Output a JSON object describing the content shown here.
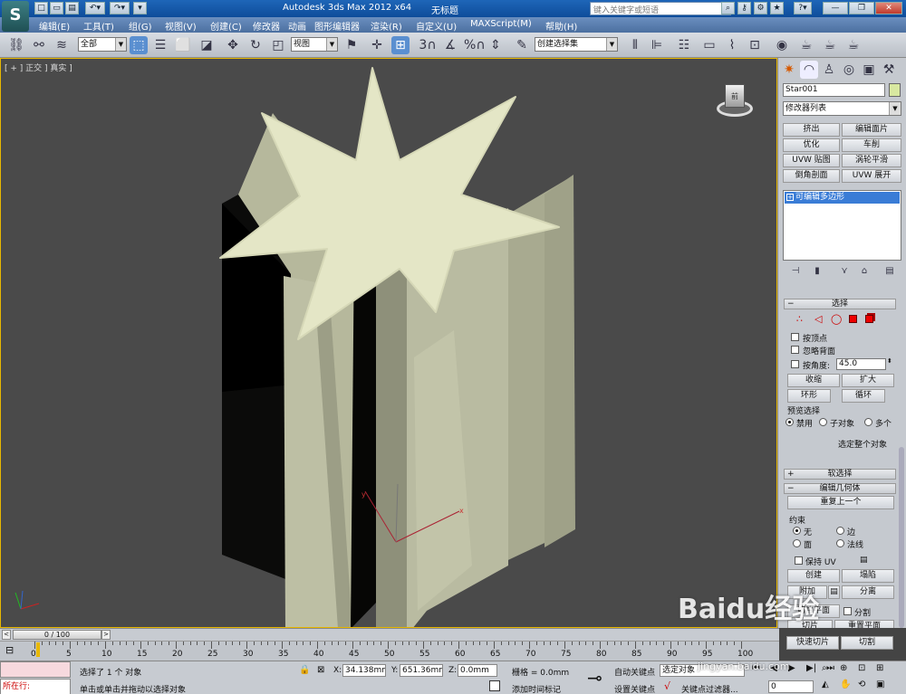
{
  "titlebar": {
    "app_title": "Autodesk 3ds Max  2012 x64",
    "doc_title": "无标题",
    "search_placeholder": "键入关键字或短语"
  },
  "menubar": {
    "items": [
      "编辑(E)",
      "工具(T)",
      "组(G)",
      "视图(V)",
      "创建(C)",
      "修改器",
      "动画",
      "图形编辑器",
      "渲染(R)",
      "自定义(U)",
      "MAXScript(M)",
      "帮助(H)"
    ]
  },
  "toolbar": {
    "selection_filter": "全部",
    "reference_coord": "视图",
    "named_selection": "创建选择集",
    "snap_label": "3",
    "percent_label": "%"
  },
  "viewport": {
    "label": "[ + ] 正交 ] 真实 ]",
    "viewcube_label": "前"
  },
  "panel": {
    "object_name": "Star001",
    "modifier_list": "修改器列表",
    "mod_buttons": [
      "挤出",
      "编辑面片",
      "优化",
      "车削",
      "UVW 贴图",
      "涡轮平滑",
      "倒角剖面",
      "UVW 展开"
    ],
    "stack_item": "可编辑多边形",
    "selection": {
      "header": "选择",
      "by_vertex": "按顶点",
      "ignore_backface": "忽略背面",
      "by_angle": "按角度:",
      "angle_value": "45.0",
      "shrink": "收缩",
      "grow": "扩大",
      "ring": "环形",
      "loop": "循环",
      "preview_title": "预览选择",
      "preview_off": "禁用",
      "preview_sub": "子对象",
      "preview_multi": "多个",
      "whole_object": "选定整个对象"
    },
    "soft_selection": "软选择",
    "edit_geometry": {
      "header": "编辑几何体",
      "repeat_last": "重复上一个",
      "constraints": "约束",
      "c_none": "无",
      "c_edge": "边",
      "c_face": "面",
      "c_normal": "法线",
      "preserve_uv": "保持 UV",
      "create": "创建",
      "collapse": "塌陷",
      "attach": "附加",
      "detach": "分离",
      "slice_plane": "切片平面",
      "split": "分割",
      "slice": "切片",
      "reset_plane": "重置平面",
      "quickslice": "快速切片",
      "cut": "切割"
    }
  },
  "timeline": {
    "frame_display": "0 / 100",
    "ticks": [
      "0",
      "5",
      "10",
      "15",
      "20",
      "25",
      "30",
      "35",
      "40",
      "45",
      "50",
      "55",
      "60",
      "65",
      "70",
      "75",
      "80",
      "85",
      "90",
      "95",
      "100"
    ]
  },
  "status": {
    "running_label": "所在行:",
    "selected_msg": "选择了 1 个 对象",
    "hint_msg": "单击或单击并拖动以选择对象",
    "x_label": "X:",
    "x_value": "34.138mm",
    "y_label": "Y:",
    "y_value": "651.36mm",
    "z_label": "Z:",
    "z_value": "0.0mm",
    "grid": "栅格 = 0.0mm",
    "add_time_tag": "添加时间标记",
    "auto_key": "自动关键点",
    "set_key": "设置关键点",
    "selected_obj": "选定对象",
    "key_filters": "关键点过滤器...",
    "frame_value": "0"
  },
  "watermark": {
    "brand": "Baidu经验",
    "url": "jingyan.baidu.com"
  }
}
